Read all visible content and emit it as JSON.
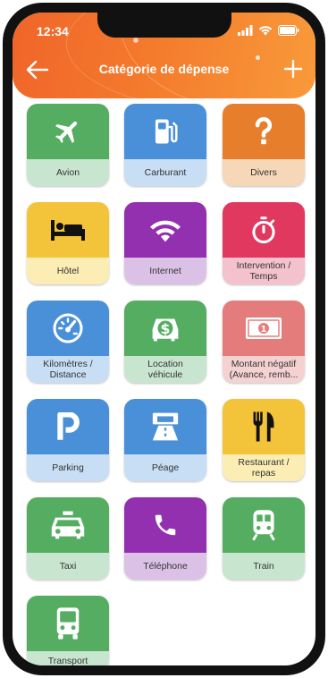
{
  "status_bar": {
    "time": "12:34"
  },
  "header": {
    "title": "Catégorie de dépense"
  },
  "categories": [
    {
      "label": "Avion",
      "icon": "airplane-icon",
      "color": "#55ad62",
      "light": "#c8e6cf"
    },
    {
      "label": "Carburant",
      "icon": "fuel-pump-icon",
      "color": "#4a90d9",
      "light": "#c8def5"
    },
    {
      "label": "Divers",
      "icon": "question-mark-icon",
      "color": "#e67e2b",
      "light": "#f6d7b8"
    },
    {
      "label": "Hôtel",
      "icon": "bed-icon",
      "color": "#f3c43a",
      "light": "#fbedb3"
    },
    {
      "label": "Internet",
      "icon": "wifi-icon",
      "color": "#9230b0",
      "light": "#dcc1e6"
    },
    {
      "label": "Intervention /\nTemps",
      "icon": "stopwatch-icon",
      "color": "#e0385f",
      "light": "#f3c2cc"
    },
    {
      "label": "Kilomètres /\nDistance",
      "icon": "speedometer-icon",
      "color": "#4a90d9",
      "light": "#c8def5"
    },
    {
      "label": "Location\nvéhicule",
      "icon": "car-rental-icon",
      "color": "#55ad62",
      "light": "#c8e6cf"
    },
    {
      "label": "Montant négatif\n(Avance, remb...",
      "icon": "banknote-icon",
      "color": "#e57c7c",
      "light": "#f5d2d2"
    },
    {
      "label": "Parking",
      "icon": "parking-icon",
      "color": "#4a90d9",
      "light": "#c8def5"
    },
    {
      "label": "Péage",
      "icon": "toll-road-icon",
      "color": "#4a90d9",
      "light": "#c8def5"
    },
    {
      "label": "Restaurant /\nrepas",
      "icon": "fork-knife-icon",
      "color": "#f3c43a",
      "light": "#fbedb3"
    },
    {
      "label": "Taxi",
      "icon": "taxi-icon",
      "color": "#55ad62",
      "light": "#c8e6cf"
    },
    {
      "label": "Téléphone",
      "icon": "phone-icon",
      "color": "#9230b0",
      "light": "#dcc1e6"
    },
    {
      "label": "Train",
      "icon": "train-icon",
      "color": "#55ad62",
      "light": "#c8e6cf"
    },
    {
      "label": "Transport",
      "icon": "bus-icon",
      "color": "#55ad62",
      "light": "#c8e6cf"
    }
  ]
}
